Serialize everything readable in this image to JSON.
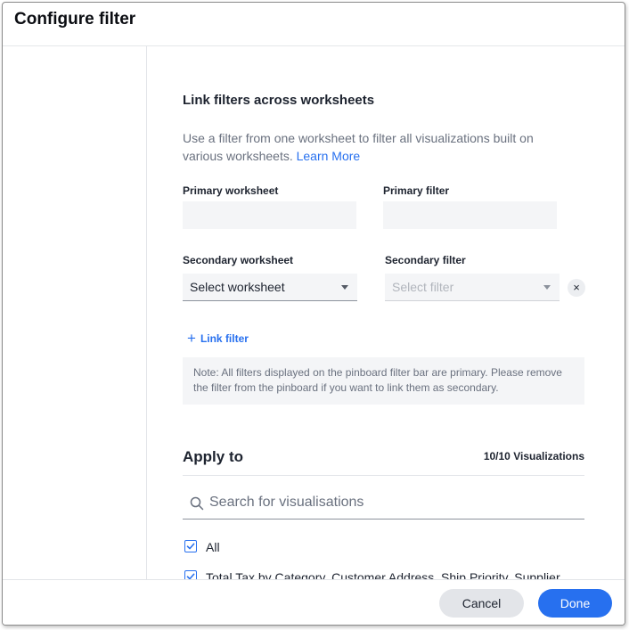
{
  "dialog": {
    "title": "Configure filter"
  },
  "link_section": {
    "title": "Link filters across worksheets",
    "description": "Use a filter from one worksheet to filter all visualizations built on various worksheets.",
    "learn_more": "Learn More",
    "primary_worksheet_label": "Primary worksheet",
    "primary_worksheet_value": "",
    "primary_filter_label": "Primary filter",
    "primary_filter_value": "",
    "secondary_worksheet_label": "Secondary worksheet",
    "secondary_worksheet_placeholder": "Select worksheet",
    "secondary_filter_label": "Secondary filter",
    "secondary_filter_placeholder": "Select filter",
    "clear_icon": "×",
    "link_filter_icon": "+",
    "link_filter_label": "Link filter",
    "note": "Note: All filters displayed on the pinboard filter bar are primary. Please remove the filter from the pinboard if you want to link them as secondary."
  },
  "apply_to": {
    "title": "Apply to",
    "count": "10/10 Visualizations",
    "search_placeholder": "Search for visualisations",
    "items": [
      {
        "label": "All",
        "checked": true
      },
      {
        "label": "Total Tax by Category, Customer Address, Ship Priority, Supplier …",
        "checked": true
      }
    ]
  },
  "footer": {
    "cancel_label": "Cancel",
    "done_label": "Done"
  },
  "colors": {
    "accent": "#2770ef",
    "muted_text": "#6a717f",
    "field_bg": "#f4f5f7"
  },
  "icons": {
    "search": "search-icon",
    "checkbox": "checkmark-icon",
    "clear": "close-icon",
    "dropdown": "caret-down-icon",
    "add": "plus-icon"
  }
}
